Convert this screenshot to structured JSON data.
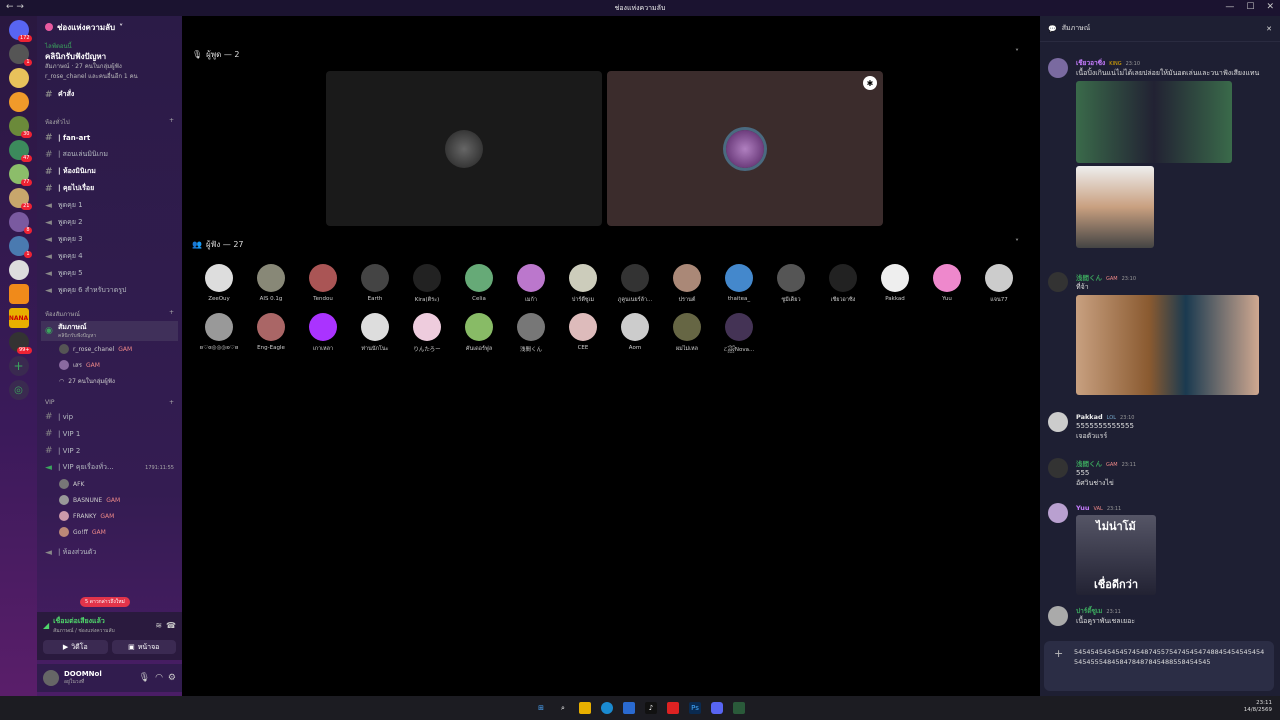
{
  "window": {
    "title": "ช่องแห่งความลับ"
  },
  "sidebar": {
    "server_name": "ช่องแห่งความลับ",
    "event": {
      "status": "ไลฟ์ตอนนี้",
      "title": "คลินิกรับฟังปัญหา",
      "host": "สัมภาษณ์ · 27 คนในกลุ่มผู้ฟัง",
      "speaker": "r_rose_chanel และคนอื่นอีก 1 คน"
    },
    "commands_channel": "คำสั่ง",
    "categories": [
      {
        "name": "ห้องทั่วไป",
        "channels": [
          "| fan-art",
          "| สอนเล่นมินิเกม",
          "| ห้องมินิเกม",
          "| คุยไปเรื่อย",
          "พูดคุย 1",
          "พูดคุย 2",
          "พูดคุย 3",
          "พูดคุย 4",
          "พูดคุย 5",
          "พูดคุย 6 สำหรับวาดรูป"
        ]
      },
      {
        "name": "ห้องสัมภาษณ์",
        "channels": [
          "สัมภาษณ์"
        ]
      },
      {
        "name": "VIP",
        "channels": [
          "| vip",
          "| VIP 1",
          "| VIP 2",
          "| VIP คุยเรื่องทั่ว..."
        ]
      }
    ],
    "stage_channel": {
      "name": "สัมภาษณ์",
      "topic": "คลินิกรับฟังปัญหา",
      "members": [
        {
          "name": "r_rose_chanel",
          "tag": "GAM"
        },
        {
          "name": "เสร",
          "tag": "GAM"
        }
      ],
      "listeners": "27 คนในกลุ่มผู้ฟัง"
    },
    "vip_timer": "1791:11:55",
    "vip_members": [
      {
        "name": "AFK"
      },
      {
        "name": "BASNUNE",
        "tag": "GAM"
      },
      {
        "name": "FRANKY",
        "tag": "GAM"
      },
      {
        "name": "Go!ff",
        "tag": "GAM"
      }
    ],
    "extra_channel": "| ห้องส่วนตัว",
    "new_badge": "5 ดาวกล่าวถึงใหม่",
    "voice": {
      "status": "เชื่อมต่อเสียงแล้ว",
      "location": "สัมภาษณ์ / ช่องแห่งความลับ",
      "video": "วิดีโอ",
      "screen": "หน้าจอ"
    },
    "user": {
      "name": "DOOMNol",
      "status": "อยู่ในวงที่"
    }
  },
  "stage": {
    "speakers_label": "ผู้พูด — 2",
    "audience_label": "ผู้ฟัง — 27",
    "audience": [
      "ZeeOuy",
      "AIS 0.1g",
      "Tendou",
      "Earth",
      "Kira(ติระ)",
      "Celia",
      "เมก้า",
      "ปาร์ตี้ซูเม",
      "ภูคูนเนยร์ล้า...",
      "ปรานต์",
      "thaitea_",
      "ซูมี่เด็ยว",
      "เชียวอาซิ่ง",
      "Pakkad",
      "Yuu",
      "แจน77",
      "ʚ♡ɞ◎◎◎ʚ♡ɞ",
      "Eng-Eagle",
      "เกาเหลา",
      "ท่านนักโนะ",
      "りんたろー",
      "คันเดอร์ฟูล",
      "浅間くん",
      "CEE",
      "Aom",
      "ผมไม่เหล",
      "ℰ꫞Nova..."
    ]
  },
  "chat": {
    "title": "สัมภาษณ์",
    "messages": [
      {
        "user": "เชียวอาซิ่ง",
        "tag": "KING",
        "time": "23:10",
        "text": "เนื้อปิ้งเกินแน่ไม่ได้เลยปล่อยให้มันอดเล่นและวนาฟังเสียงแทน",
        "color": "#c77dff"
      },
      {
        "user": "浅間くん",
        "tag": "GAM",
        "time": "23:10",
        "text": "ที่จ้า",
        "color": "#3ba55d"
      },
      {
        "user": "Pakkad",
        "tag": "LOL",
        "time": "23:10",
        "text": "5555555555555",
        "text2": "เจอตัวแรร์",
        "color": "#e5e5e5"
      },
      {
        "user": "浅間くん",
        "tag": "GAM",
        "time": "23:11",
        "text": "555",
        "text2": "อัศวินช่างไข่",
        "color": "#3ba55d"
      },
      {
        "user": "Yuu",
        "tag": "VAL",
        "time": "23:11",
        "text": "",
        "meme_top": "ไม่น่าโม้",
        "meme_bottom": "เชื่อดีกว่า",
        "color": "#c77dff"
      },
      {
        "user": "ปาร์ตี้ซูเม",
        "tag": "",
        "time": "23:11",
        "text": "เนื้อคูราพันเชลเยอะ",
        "color": "#3ba55d"
      }
    ],
    "input_text": "5454545454545745487455754745454748845454545454545455548458478487845488558454545"
  },
  "taskbar": {
    "time": "23:11",
    "date": "14/8/2569"
  }
}
